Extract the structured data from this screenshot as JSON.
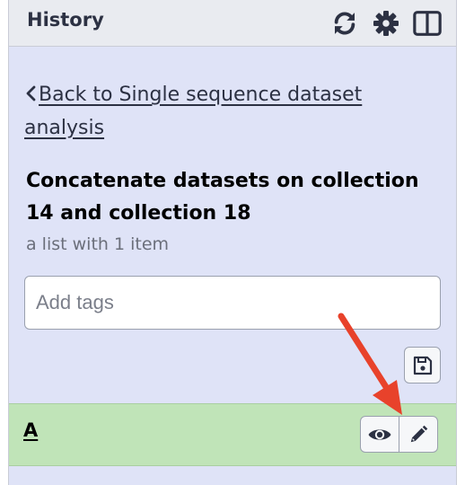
{
  "header": {
    "title": "History",
    "icons": [
      "refresh-icon",
      "gear-icon",
      "columns-icon"
    ]
  },
  "back_link": {
    "label": "Back to Single sequence dataset analysis"
  },
  "collection": {
    "title": "Concatenate datasets on collection 14 and collection 18",
    "subtitle": "a list with 1 item"
  },
  "tags": {
    "placeholder": "Add tags",
    "value": ""
  },
  "elements": [
    {
      "name": "A",
      "actions": [
        "eye-icon",
        "pencil-icon"
      ]
    }
  ],
  "colors": {
    "panel_bg": "#dfe3f7",
    "header_bg": "#e9ebf0",
    "element_bg": "#c0e4b8",
    "annotation_arrow": "#e8422b"
  }
}
